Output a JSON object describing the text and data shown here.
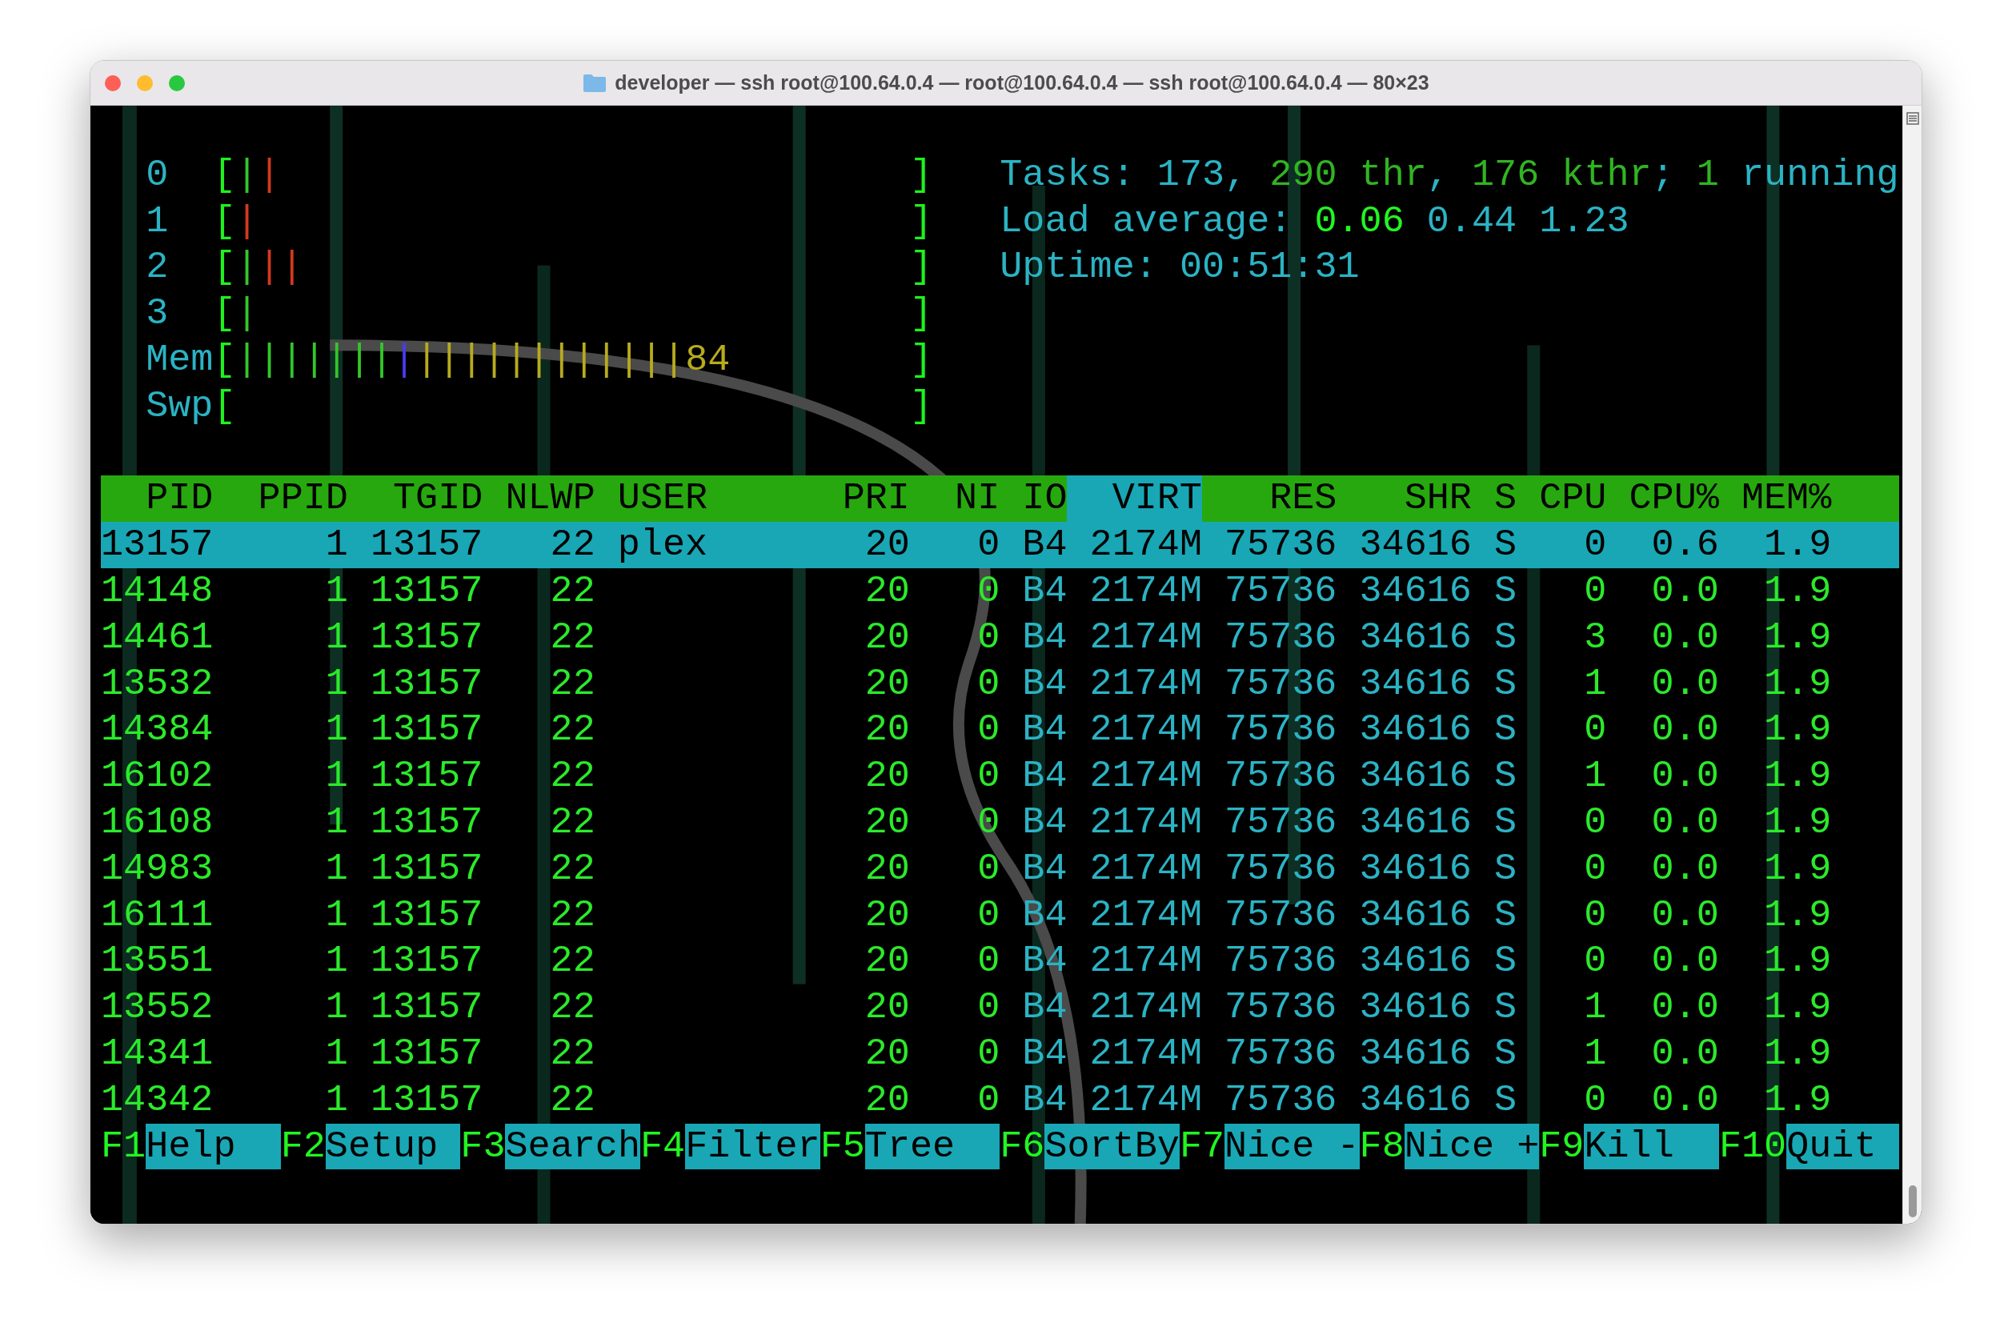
{
  "window": {
    "title": "developer — ssh root@100.64.0.4 — root@100.64.0.4 — ssh root@100.64.0.4 — 80×23"
  },
  "meters": [
    {
      "label": "0",
      "open": "[",
      "segments": [
        {
          "text": "|",
          "color": "#34c62a"
        },
        {
          "text": "|",
          "color": "#d23a1c"
        }
      ],
      "close": "]"
    },
    {
      "label": "1",
      "open": "[",
      "segments": [
        {
          "text": "|",
          "color": "#d23a1c"
        }
      ],
      "close": "]"
    },
    {
      "label": "2",
      "open": "[",
      "segments": [
        {
          "text": "|",
          "color": "#34c62a"
        },
        {
          "text": "|",
          "color": "#d23a1c"
        },
        {
          "text": "|",
          "color": "#d23a1c"
        }
      ],
      "close": "]"
    },
    {
      "label": "3",
      "open": "[",
      "segments": [
        {
          "text": "|",
          "color": "#34c62a"
        }
      ],
      "close": "]"
    },
    {
      "label": "Mem",
      "open": "[",
      "segments": [
        {
          "text": "|||||||",
          "color": "#34c62a"
        },
        {
          "text": "|",
          "color": "#4a3af0"
        },
        {
          "text": "||||||||||||",
          "color": "#b7ab1e"
        }
      ],
      "value": "84",
      "close": "]"
    },
    {
      "label": "Swp",
      "open": "[",
      "close": "]"
    }
  ],
  "summary": [
    [
      {
        "text": "Tasks: ",
        "kind": "label"
      },
      {
        "text": "173",
        "kind": "value"
      },
      {
        "text": ", ",
        "kind": "label"
      },
      {
        "text": "290 thr",
        "kind": "thread"
      },
      {
        "text": ", ",
        "kind": "label"
      },
      {
        "text": "176 kthr",
        "kind": "thread"
      },
      {
        "text": "; ",
        "kind": "label"
      },
      {
        "text": "1",
        "kind": "thread"
      },
      {
        "text": " running",
        "kind": "label"
      }
    ],
    [
      {
        "text": "Load average: ",
        "kind": "label"
      },
      {
        "text": "0.06",
        "kind": "bright"
      },
      {
        "text": " 0.44 1.23",
        "kind": "value"
      }
    ],
    [
      {
        "text": "Uptime: ",
        "kind": "label"
      },
      {
        "text": "00:51:31",
        "kind": "value"
      }
    ]
  ],
  "table": {
    "columns": [
      {
        "label": "PID",
        "selected": false
      },
      {
        "label": "PPID",
        "selected": false
      },
      {
        "label": "TGID",
        "selected": false
      },
      {
        "label": "NLWP",
        "selected": false
      },
      {
        "label": "USER",
        "selected": false
      },
      {
        "label": "PRI",
        "selected": false
      },
      {
        "label": "NI",
        "selected": false
      },
      {
        "label": "IO",
        "selected": false
      },
      {
        "label": "VIRT",
        "selected": true
      },
      {
        "label": "RES",
        "selected": false
      },
      {
        "label": "SHR",
        "selected": false
      },
      {
        "label": "S",
        "selected": false
      },
      {
        "label": "CPU",
        "selected": false
      },
      {
        "label": "CPU%",
        "selected": false
      },
      {
        "label": "MEM%",
        "selected": false
      }
    ],
    "rows": [
      {
        "selected": true,
        "cells": [
          "13157",
          "1",
          "13157",
          "22",
          "plex",
          "20",
          "0",
          "B4",
          "2174M",
          "75736",
          "34616",
          "S",
          "0",
          "0.6",
          "1.9"
        ]
      },
      {
        "selected": false,
        "cells": [
          "14148",
          "1",
          "13157",
          "22",
          "",
          "20",
          "0",
          "B4",
          "2174M",
          "75736",
          "34616",
          "S",
          "0",
          "0.0",
          "1.9"
        ]
      },
      {
        "selected": false,
        "cells": [
          "14461",
          "1",
          "13157",
          "22",
          "",
          "20",
          "0",
          "B4",
          "2174M",
          "75736",
          "34616",
          "S",
          "3",
          "0.0",
          "1.9"
        ]
      },
      {
        "selected": false,
        "cells": [
          "13532",
          "1",
          "13157",
          "22",
          "",
          "20",
          "0",
          "B4",
          "2174M",
          "75736",
          "34616",
          "S",
          "1",
          "0.0",
          "1.9"
        ]
      },
      {
        "selected": false,
        "cells": [
          "14384",
          "1",
          "13157",
          "22",
          "",
          "20",
          "0",
          "B4",
          "2174M",
          "75736",
          "34616",
          "S",
          "0",
          "0.0",
          "1.9"
        ]
      },
      {
        "selected": false,
        "cells": [
          "16102",
          "1",
          "13157",
          "22",
          "",
          "20",
          "0",
          "B4",
          "2174M",
          "75736",
          "34616",
          "S",
          "1",
          "0.0",
          "1.9"
        ]
      },
      {
        "selected": false,
        "cells": [
          "16108",
          "1",
          "13157",
          "22",
          "",
          "20",
          "0",
          "B4",
          "2174M",
          "75736",
          "34616",
          "S",
          "0",
          "0.0",
          "1.9"
        ]
      },
      {
        "selected": false,
        "cells": [
          "14983",
          "1",
          "13157",
          "22",
          "",
          "20",
          "0",
          "B4",
          "2174M",
          "75736",
          "34616",
          "S",
          "0",
          "0.0",
          "1.9"
        ]
      },
      {
        "selected": false,
        "cells": [
          "16111",
          "1",
          "13157",
          "22",
          "",
          "20",
          "0",
          "B4",
          "2174M",
          "75736",
          "34616",
          "S",
          "0",
          "0.0",
          "1.9"
        ]
      },
      {
        "selected": false,
        "cells": [
          "13551",
          "1",
          "13157",
          "22",
          "",
          "20",
          "0",
          "B4",
          "2174M",
          "75736",
          "34616",
          "S",
          "0",
          "0.0",
          "1.9"
        ]
      },
      {
        "selected": false,
        "cells": [
          "13552",
          "1",
          "13157",
          "22",
          "",
          "20",
          "0",
          "B4",
          "2174M",
          "75736",
          "34616",
          "S",
          "1",
          "0.0",
          "1.9"
        ]
      },
      {
        "selected": false,
        "cells": [
          "14341",
          "1",
          "13157",
          "22",
          "",
          "20",
          "0",
          "B4",
          "2174M",
          "75736",
          "34616",
          "S",
          "1",
          "0.0",
          "1.9"
        ]
      },
      {
        "selected": false,
        "cells": [
          "14342",
          "1",
          "13157",
          "22",
          "",
          "20",
          "0",
          "B4",
          "2174M",
          "75736",
          "34616",
          "S",
          "0",
          "0.0",
          "1.9"
        ]
      }
    ]
  },
  "function_keys": [
    {
      "key": "F1",
      "label": "Help"
    },
    {
      "key": "F2",
      "label": "Setup"
    },
    {
      "key": "F3",
      "label": "Search"
    },
    {
      "key": "F4",
      "label": "Filter"
    },
    {
      "key": "F5",
      "label": "Tree"
    },
    {
      "key": "F6",
      "label": "SortBy"
    },
    {
      "key": "F7",
      "label": "Nice -"
    },
    {
      "key": "F8",
      "label": "Nice +"
    },
    {
      "key": "F9",
      "label": "Kill"
    },
    {
      "key": "F10",
      "label": "Quit"
    }
  ]
}
